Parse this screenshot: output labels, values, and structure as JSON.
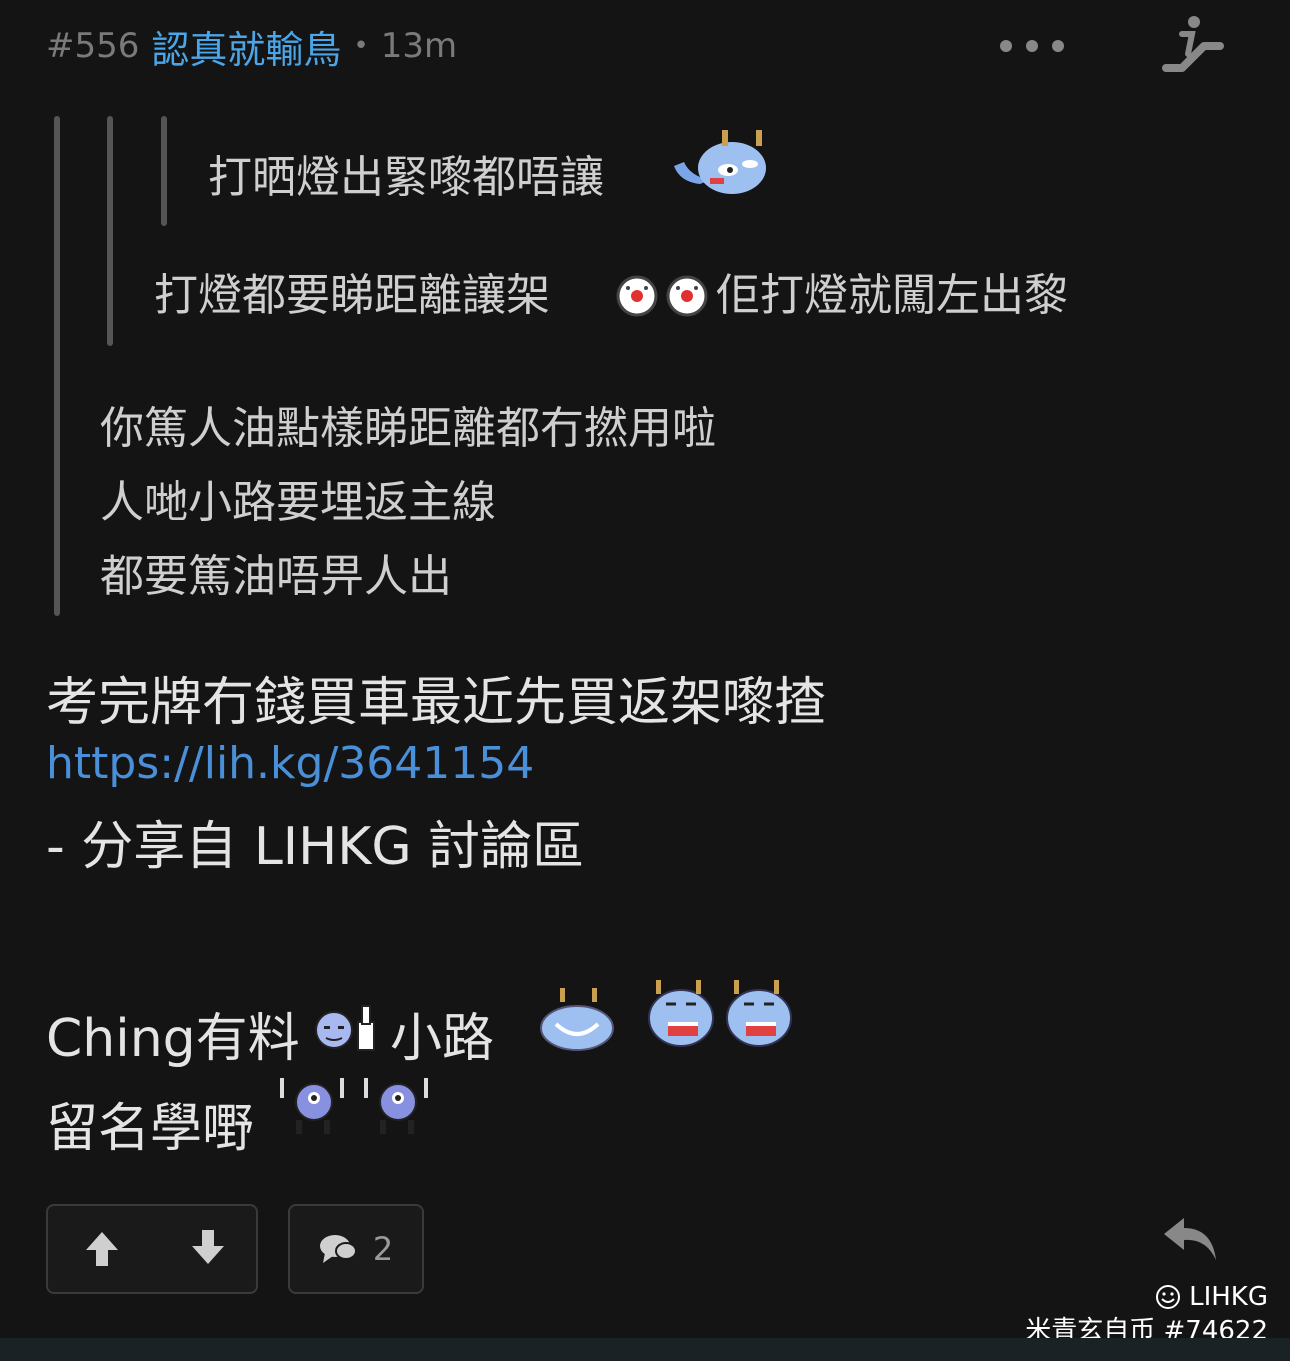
{
  "post": {
    "number": "#556",
    "username": "認真就輸鳥",
    "separator": "•",
    "time": "13m"
  },
  "quotes": {
    "level3": {
      "text": "打晒燈出緊嚟都唔讓"
    },
    "level2": {
      "text_before": "打燈都要睇距離讓架",
      "text_after": "佢打燈就闖左出黎"
    },
    "level1": {
      "lines": [
        "你篤人油點樣睇距離都冇撚用啦",
        "人哋小路要埋返主線",
        "都要篤油唔畀人出"
      ]
    }
  },
  "body": {
    "line1": "考完牌冇錢買車最近先買返架嚟揸",
    "link": "https://lih.kg/3641154",
    "line3": "- 分享自 LIHKG 討論區",
    "line4_a": "Ching有料",
    "line4_b": "小路",
    "line5": "留名學嘢"
  },
  "actions": {
    "comment_count": "2"
  },
  "watermark": {
    "brand": "LIHKG",
    "user": "米青玄自币 #74622"
  },
  "icons": {
    "more": "more-dots-icon",
    "escalator": "escalator-icon",
    "upvote": "arrow-up-icon",
    "downvote": "arrow-down-icon",
    "comment": "comment-bubble-icon",
    "reply": "reply-icon"
  },
  "colors": {
    "background": "#141414",
    "username": "#4aa6e8",
    "link": "#4a90d9",
    "muted": "#7a7a7a"
  }
}
